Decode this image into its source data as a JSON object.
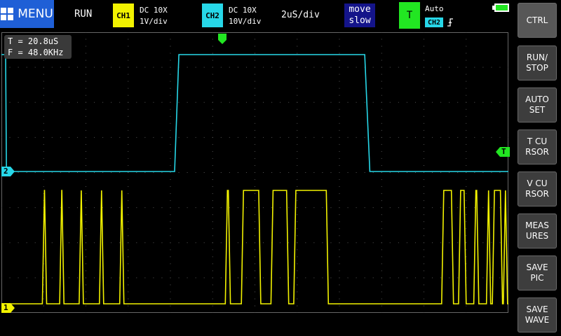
{
  "colors": {
    "ch1": "#f2f200",
    "ch2": "#27d7e8",
    "menu": "#1f5fd6",
    "trigger": "#22e622",
    "grid": "#555555"
  },
  "topbar": {
    "menu_label": "MENU",
    "run_state": "RUN",
    "ch1": {
      "badge": "CH1",
      "coupling": "DC  10X",
      "scale": "1V/div"
    },
    "ch2": {
      "badge": "CH2",
      "coupling": "DC  10X",
      "scale": "10V/div"
    },
    "timebase": "2uS/div",
    "move": {
      "line1": "move",
      "line2": "slow"
    },
    "trigger": {
      "badge": "T",
      "mode": "Auto",
      "source": "CH2",
      "edge_icon": "rising-edge-icon"
    }
  },
  "measurements": {
    "period": "T = 20.8uS",
    "frequency": "F = 48.0KHz"
  },
  "markers": {
    "ch1": "1",
    "ch2": "2",
    "trigger_level": "T"
  },
  "sidebar": {
    "buttons": [
      {
        "label": "CTRL"
      },
      {
        "label": "RUN/\nSTOP"
      },
      {
        "label": "AUTO\nSET"
      },
      {
        "label": "T CU\nRSOR"
      },
      {
        "label": "V CU\nRSOR"
      },
      {
        "label": "MEAS\nURES"
      },
      {
        "label": "SAVE\nPIC"
      },
      {
        "label": "SAVE\nWAVE"
      }
    ]
  },
  "chart_data": {
    "type": "line",
    "grid_divisions": {
      "x": 12,
      "y": 8
    },
    "time_per_div": "2uS",
    "series": [
      {
        "name": "CH2",
        "color": "#27d7e8",
        "levels": {
          "low": 0,
          "high": 1
        },
        "x": [
          0,
          0.1,
          0.12,
          0.16,
          4.1,
          4.2,
          8.6,
          8.72,
          12.0
        ],
        "values": [
          1,
          1,
          0,
          0,
          0,
          1,
          1,
          0,
          0
        ]
      },
      {
        "name": "CH1",
        "color": "#f2f200",
        "levels": {
          "low": 0,
          "high": 1
        },
        "pulses": [
          [
            0.97,
            1.07
          ],
          [
            1.38,
            1.48
          ],
          [
            1.84,
            1.94
          ],
          [
            2.32,
            2.42
          ],
          [
            2.8,
            2.9
          ],
          [
            5.3,
            5.42
          ],
          [
            5.68,
            6.14
          ],
          [
            6.38,
            6.8
          ],
          [
            6.92,
            7.74
          ],
          [
            10.42,
            10.7
          ],
          [
            10.82,
            11.0
          ],
          [
            11.18,
            11.3
          ],
          [
            11.48,
            11.58
          ],
          [
            11.62,
            11.86
          ],
          [
            11.88,
            11.98
          ]
        ]
      }
    ]
  }
}
